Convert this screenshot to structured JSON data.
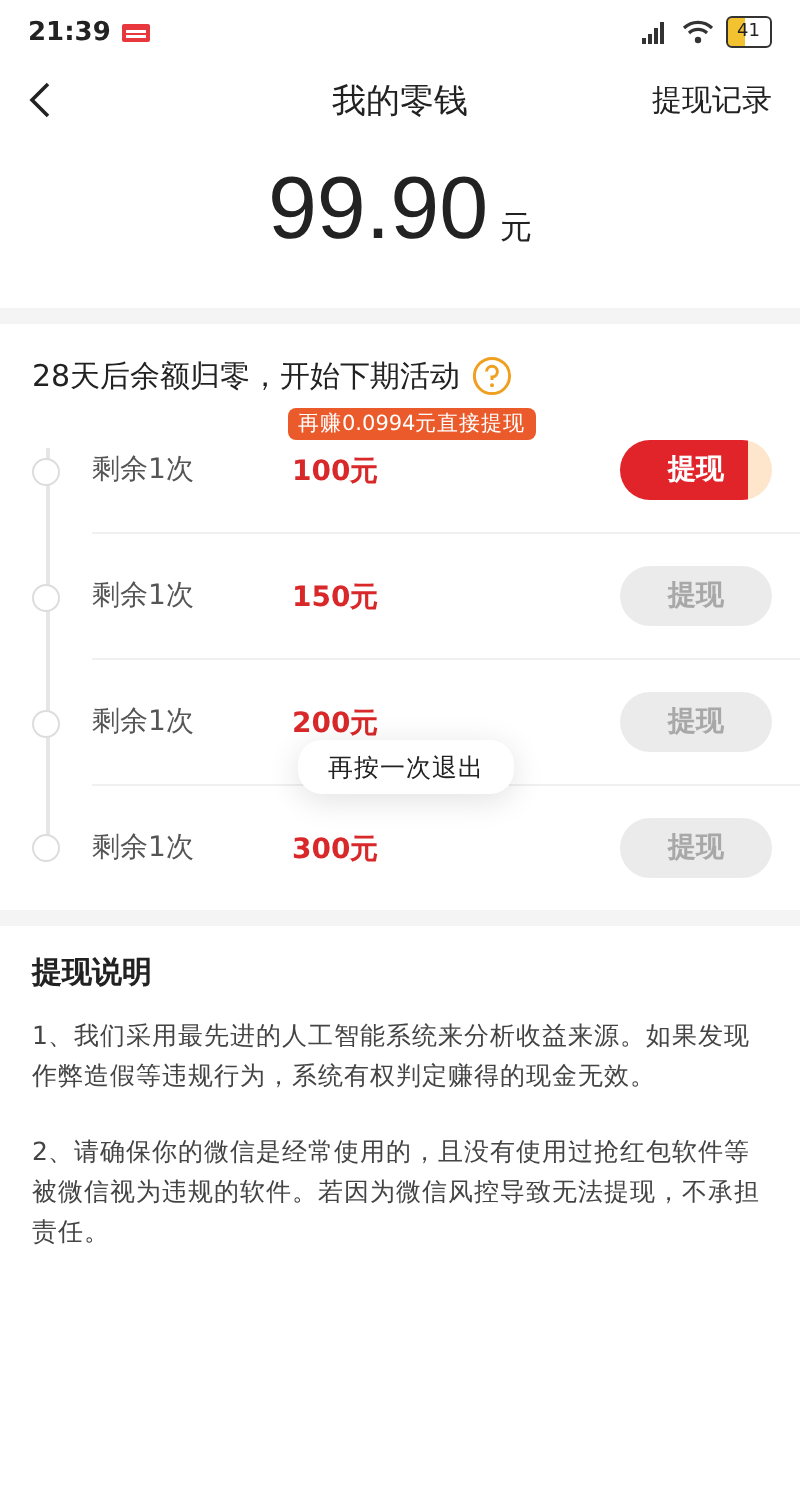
{
  "status_bar": {
    "time": "21:39",
    "battery": "41"
  },
  "header": {
    "title": "我的零钱",
    "action": "提现记录"
  },
  "balance": {
    "amount": "99.90",
    "unit": "元"
  },
  "tiers": {
    "title": "28天后余额归零，开始下期活动",
    "items": [
      {
        "remaining": "剩余1次",
        "amount": "100元",
        "tip": "再赚0.0994元直接提现",
        "button": "提现",
        "disabled": false
      },
      {
        "remaining": "剩余1次",
        "amount": "150元",
        "button": "提现",
        "disabled": true
      },
      {
        "remaining": "剩余1次",
        "amount": "200元",
        "button": "提现",
        "disabled": true
      },
      {
        "remaining": "剩余1次",
        "amount": "300元",
        "button": "提现",
        "disabled": true
      }
    ]
  },
  "notes": {
    "title": "提现说明",
    "paragraphs": [
      "1、我们采用最先进的人工智能系统来分析收益来源。如果发现作弊造假等违规行为，系统有权判定赚得的现金无效。",
      "2、请确保你的微信是经常使用的，且没有使用过抢红包软件等被微信视为违规的软件。若因为微信风控导致无法提现，不承担责任。"
    ]
  },
  "toast": "再按一次退出"
}
